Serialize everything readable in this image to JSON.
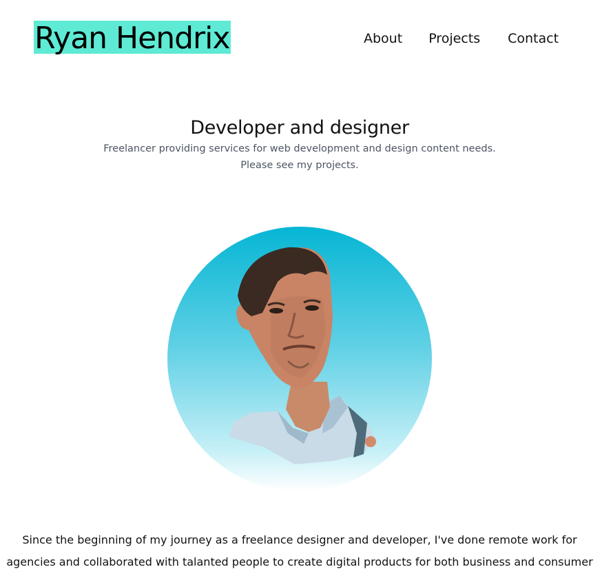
{
  "header": {
    "brand_name": "Ryan Hendrix",
    "brand_color": "#5eead4",
    "nav": {
      "about": "About",
      "projects": "Projects",
      "contact": "Contact"
    }
  },
  "hero": {
    "heading": "Developer and designer",
    "subtitle_line1": "Freelancer providing services for web development and design content needs.",
    "subtitle_line2": "Please see my projects."
  },
  "avatar": {
    "icon": "portrait-photo",
    "gradient_top": "#06b6d4",
    "gradient_bottom": "#ffffff"
  },
  "bio": {
    "line1": "Since the beginning of my journey as a freelance designer and developer, I've done remote work for",
    "line2": "agencies and collaborated with talanted people to create digital products for both business and consumer"
  }
}
